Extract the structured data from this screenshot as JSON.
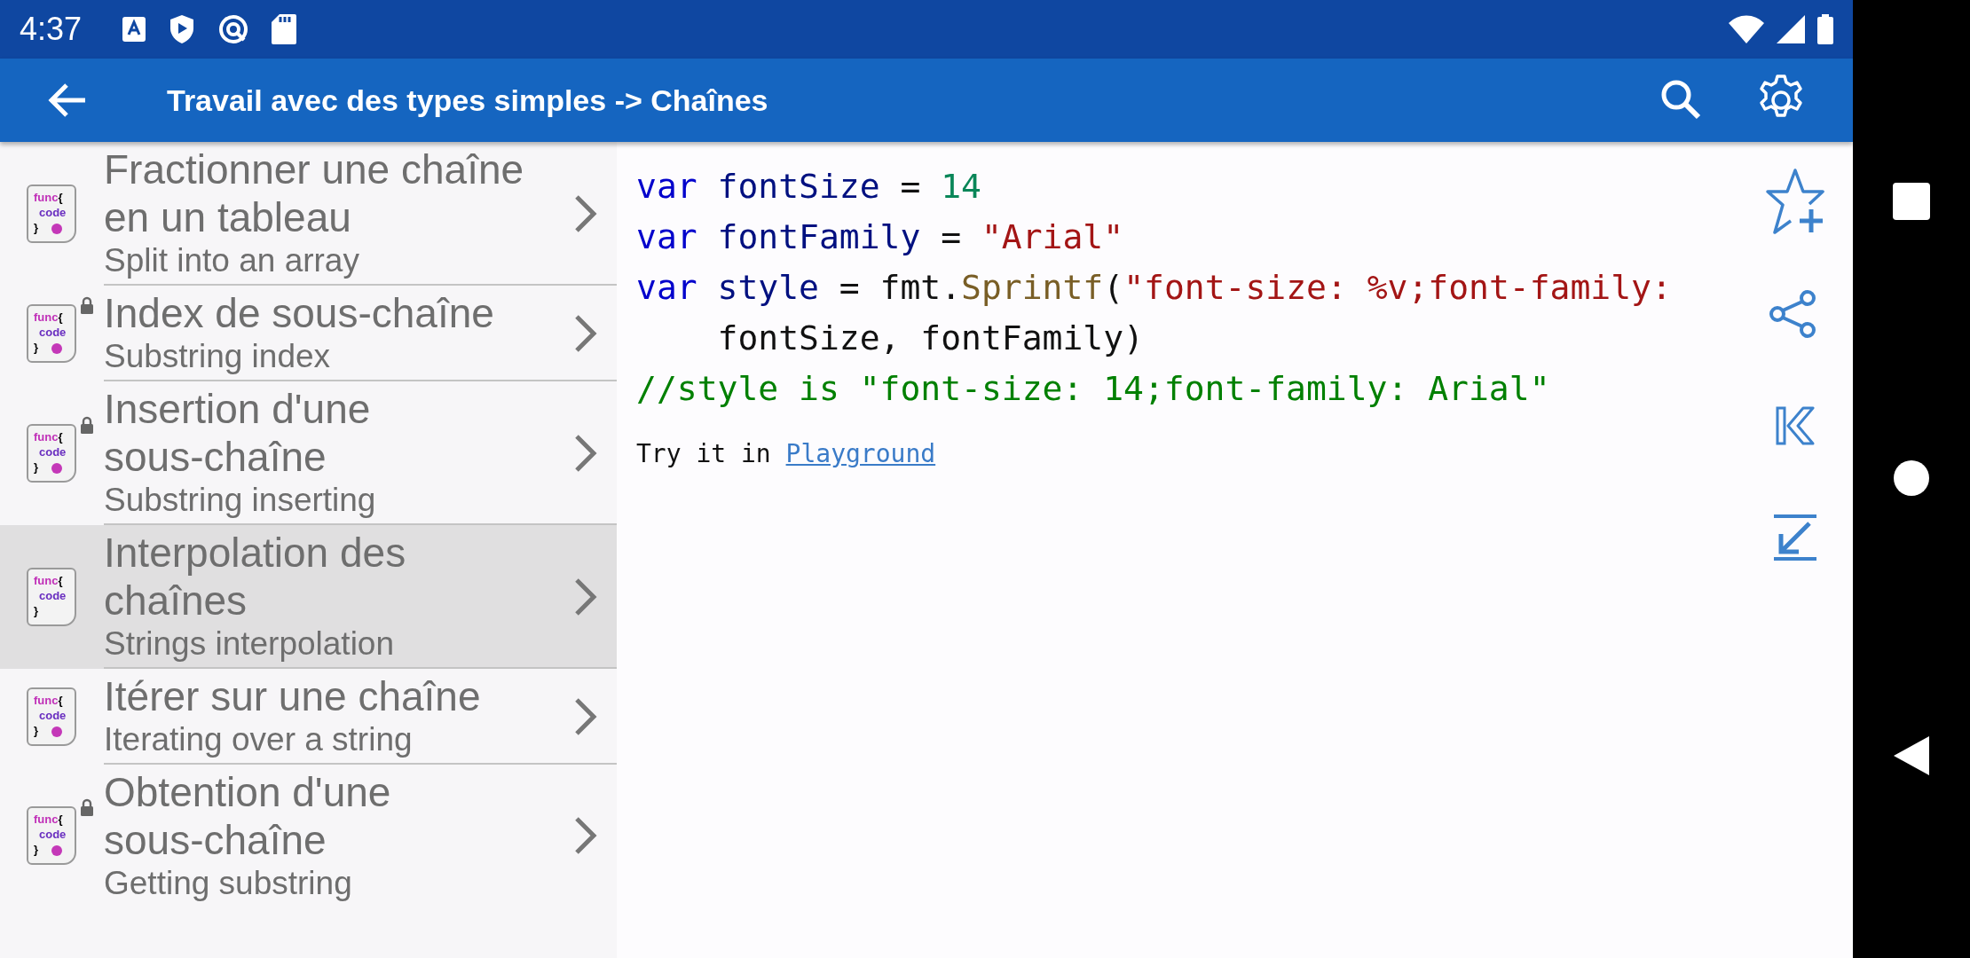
{
  "status_bar": {
    "time": "4:37"
  },
  "app_bar": {
    "title": "Travail avec des types simples -> Chaînes"
  },
  "items": [
    {
      "title": "Fractionner une chaîne en un tableau",
      "subtitle": "Split into an array",
      "icon_text": [
        "func",
        "{",
        "code",
        "}"
      ],
      "locked": false,
      "dot": true,
      "selected": false
    },
    {
      "title": "Index de sous-chaîne",
      "subtitle": "Substring index",
      "icon_text": [
        "func",
        "{",
        "code",
        "}"
      ],
      "locked": true,
      "dot": true,
      "selected": false
    },
    {
      "title": "Insertion d'une sous-chaîne",
      "subtitle": "Substring inserting",
      "icon_text": [
        "func",
        "{",
        "code",
        "}"
      ],
      "locked": true,
      "dot": true,
      "selected": false
    },
    {
      "title": "Interpolation des chaînes",
      "subtitle": "Strings interpolation",
      "icon_text": [
        "func",
        "{",
        "code",
        "}"
      ],
      "locked": false,
      "dot": false,
      "selected": true
    },
    {
      "title": "Itérer sur une chaîne",
      "subtitle": "Iterating over a string",
      "icon_text": [
        "func",
        "{",
        "code",
        "}"
      ],
      "locked": false,
      "dot": true,
      "selected": false
    },
    {
      "title": "Obtention d'une sous-chaîne",
      "subtitle": "Getting substring",
      "icon_text": [
        "func",
        "{",
        "code",
        "}"
      ],
      "locked": true,
      "dot": true,
      "selected": false
    }
  ],
  "code": [
    [
      {
        "kind": "keyword",
        "text": "var"
      },
      {
        "kind": "ident",
        "text": " fontSize "
      },
      {
        "kind": "plain",
        "text": "= "
      },
      {
        "kind": "number",
        "text": "14"
      }
    ],
    [
      {
        "kind": "keyword",
        "text": "var"
      },
      {
        "kind": "ident",
        "text": " fontFamily "
      },
      {
        "kind": "plain",
        "text": "= "
      },
      {
        "kind": "string",
        "text": "\"Arial\""
      }
    ],
    [
      {
        "kind": "keyword",
        "text": "var"
      },
      {
        "kind": "ident",
        "text": " style "
      },
      {
        "kind": "plain",
        "text": "= fmt."
      },
      {
        "kind": "func",
        "text": "Sprintf"
      },
      {
        "kind": "plain",
        "text": "("
      },
      {
        "kind": "string",
        "text": "\"font-size: %v;font-family:"
      }
    ],
    [
      {
        "kind": "plain",
        "text": "    fontSize, fontFamily)"
      }
    ],
    [
      {
        "kind": "comment",
        "text": "//style is \"font-size: 14;font-family: Arial\""
      }
    ]
  ],
  "try_it": {
    "text": "Try it in",
    "link": "Playground"
  }
}
